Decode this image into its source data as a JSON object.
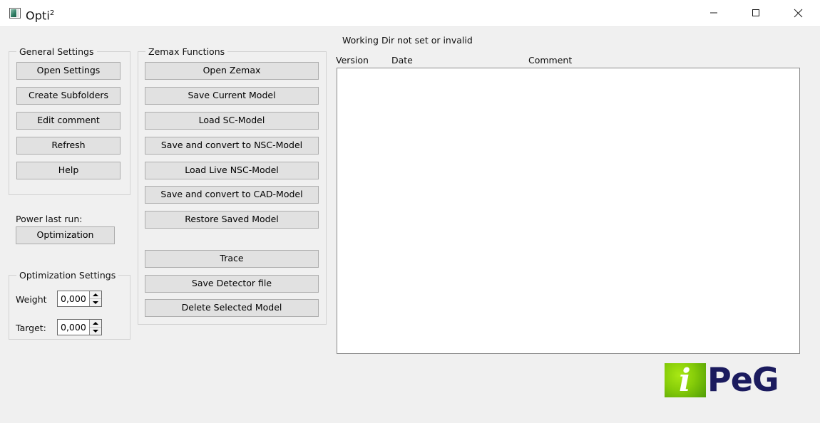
{
  "window": {
    "title": "Opti",
    "title_superscript": "2",
    "icon": "app-icon",
    "controls": {
      "minimize": "minimize",
      "maximize": "maximize",
      "close": "close"
    }
  },
  "colors": {
    "window_background": "#f0f0f0",
    "titlebar_background": "#ffffff",
    "button_face": "#e1e1e1",
    "button_border": "#adadad",
    "group_border": "#d2d2d2",
    "list_background": "#ffffff",
    "list_border": "#8a8a8a",
    "logo_green": "#86cc09",
    "logo_navy": "#1b1b5e",
    "icon_teal": "#2e7d63"
  },
  "general_settings": {
    "title": "General Settings",
    "buttons": [
      {
        "label": "Open Settings",
        "name": "open-settings-button"
      },
      {
        "label": "Create Subfolders",
        "name": "create-subfolders-button"
      },
      {
        "label": "Edit comment",
        "name": "edit-comment-button"
      },
      {
        "label": "Refresh",
        "name": "refresh-button"
      },
      {
        "label": "Help",
        "name": "help-button"
      }
    ]
  },
  "power_last_run": {
    "label": "Power last run:",
    "button_label": "Optimization"
  },
  "optimization_settings": {
    "title": "Optimization Settings",
    "fields": [
      {
        "label": "Weight",
        "value": "0,000"
      },
      {
        "label": "Target:",
        "value": "0,000"
      }
    ]
  },
  "zemax_functions": {
    "title": "Zemax Functions",
    "buttons_group_1": [
      {
        "label": "Open Zemax",
        "name": "open-zemax-button"
      },
      {
        "label": "Save Current Model",
        "name": "save-current-model-button"
      },
      {
        "label": "Load SC-Model",
        "name": "load-sc-model-button"
      },
      {
        "label": "Save and convert to NSC-Model",
        "name": "save-convert-nsc-model-button"
      },
      {
        "label": "Load Live NSC-Model",
        "name": "load-live-nsc-model-button"
      },
      {
        "label": "Save and convert to CAD-Model",
        "name": "save-convert-cad-model-button"
      },
      {
        "label": "Restore Saved Model",
        "name": "restore-saved-model-button"
      }
    ],
    "buttons_group_2": [
      {
        "label": "Trace",
        "name": "trace-button"
      },
      {
        "label": "Save Detector file",
        "name": "save-detector-file-button"
      },
      {
        "label": "Delete Selected Model",
        "name": "delete-selected-model-button"
      }
    ]
  },
  "model_panel": {
    "status": "Working Dir not set or invalid",
    "columns": {
      "version": "Version",
      "date": "Date",
      "comment": "Comment"
    },
    "rows": []
  },
  "logo": {
    "mark_letter": "i",
    "word": "PeG"
  }
}
